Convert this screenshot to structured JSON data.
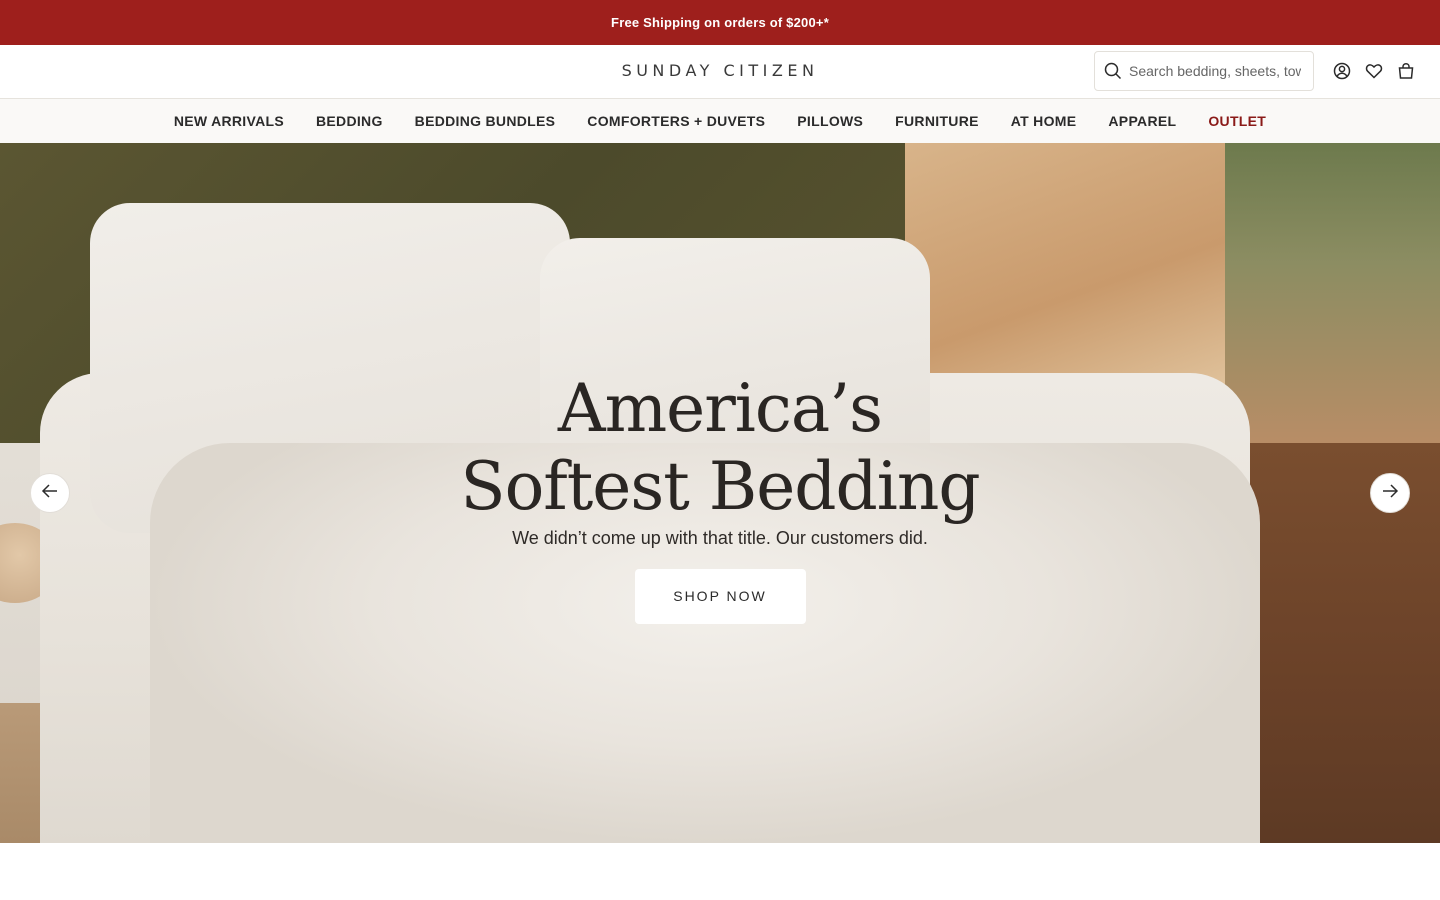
{
  "announcement": {
    "text": "Free Shipping on orders of $200+*"
  },
  "header": {
    "logo": "SUNDAY CITIZEN",
    "search": {
      "placeholder": "Search bedding, sheets, towels...",
      "value": ""
    },
    "icons": [
      "search-icon",
      "account-icon",
      "heart-icon",
      "bag-icon"
    ]
  },
  "nav": {
    "items": [
      {
        "label": "NEW ARRIVALS"
      },
      {
        "label": "BEDDING"
      },
      {
        "label": "BEDDING BUNDLES"
      },
      {
        "label": "COMFORTERS + DUVETS"
      },
      {
        "label": "PILLOWS"
      },
      {
        "label": "FURNITURE"
      },
      {
        "label": "AT HOME"
      },
      {
        "label": "APPAREL"
      },
      {
        "label": "OUTLET"
      }
    ]
  },
  "hero": {
    "title": "America’s Softest Bedding",
    "subtitle": "We didn’t come up with that title. Our customers did.",
    "cta_label": "SHOP NOW"
  },
  "colors": {
    "announcement_bg": "#9e1f1c",
    "outlet_text": "#8a1a18",
    "nav_bg": "#faf9f7"
  }
}
